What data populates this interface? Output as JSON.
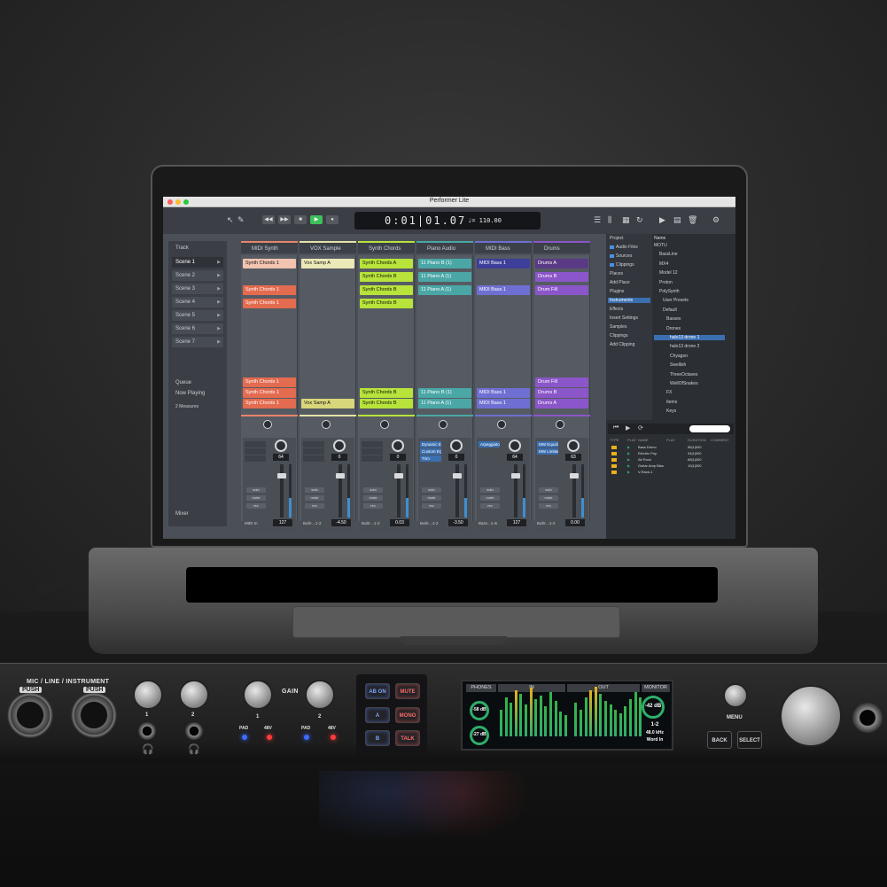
{
  "window": {
    "title": "Performer Lite"
  },
  "toolbar": {
    "counter": "0:01|01.07",
    "tempo": "♩= 110.00",
    "icons": [
      "pointer-icon",
      "pencil-icon",
      "rewind-icon",
      "fast-forward-icon",
      "stop-icon",
      "play-icon",
      "record-icon"
    ]
  },
  "clips_panel": {
    "track_label": "Track",
    "scenes": [
      "Scene 1",
      "Scene 2",
      "Scene 3",
      "Scene 4",
      "Scene 5",
      "Scene 6",
      "Scene 7"
    ],
    "queue_label": "Queue",
    "now_playing_label": "Now Playing",
    "quantize": "2 Measures",
    "mixer_label": "Mixer"
  },
  "tracks": [
    {
      "name": "MIDI Synth",
      "color": "#e8846a",
      "clips": [
        {
          "row": 0,
          "label": "Synth Chords 1",
          "color": "#f1c3b0"
        },
        {
          "row": 2,
          "label": "Synth Chords 1",
          "color": "#e36b4f"
        },
        {
          "row": 3,
          "label": "Synth Chords 1",
          "color": "#e36b4f"
        }
      ],
      "queue": [
        "Synth Chords 1",
        "Synth Chords 1",
        "Synth Chords 1"
      ],
      "queue_color": "#e36b4f",
      "inserts": [],
      "pan": "64",
      "volume": "127",
      "output": "MIDI In"
    },
    {
      "name": "VOX Sample",
      "color": "#e5e2a5",
      "clips": [
        {
          "row": 0,
          "label": "Vox Samp A",
          "color": "#ece9b8"
        }
      ],
      "queue": [
        "",
        "",
        "Vox Samp A"
      ],
      "queue_color": "#d8d67a",
      "inserts": [],
      "pan": "0",
      "volume": "-4.50",
      "output": "Built-...1-2"
    },
    {
      "name": "Synth Chords",
      "color": "#b7e33a",
      "clips": [
        {
          "row": 0,
          "label": "Synth Chords A",
          "color": "#b7e33a"
        },
        {
          "row": 1,
          "label": "Synth Chords B",
          "color": "#b7e33a"
        },
        {
          "row": 2,
          "label": "Synth Chords B",
          "color": "#b7e33a"
        },
        {
          "row": 3,
          "label": "Synth Chords B",
          "color": "#b7e33a"
        }
      ],
      "queue": [
        "",
        "Synth Chords B",
        "Synth Chords B"
      ],
      "queue_color": "#b7e33a",
      "inserts": [],
      "pan": "0",
      "volume": "0.03",
      "output": "Built-...1-2"
    },
    {
      "name": "Piano Audio",
      "color": "#4aa7a6",
      "clips": [
        {
          "row": 0,
          "label": "11 Piano B (1)",
          "color": "#4aa7a6"
        },
        {
          "row": 1,
          "label": "11 Piano A (1)",
          "color": "#4aa7a6"
        },
        {
          "row": 2,
          "label": "11 Piano A (1)",
          "color": "#4aa7a6"
        }
      ],
      "queue": [
        "",
        "11 Piano B (1)",
        "11 Piano A (1)"
      ],
      "queue_color": "#4aa7a6",
      "inserts": [
        "Dynamic E...",
        "Custom EQ",
        "Trim"
      ],
      "pan": "0",
      "volume": "-3.50",
      "output": "Built-...1-2"
    },
    {
      "name": "MIDI Bass",
      "color": "#6f6fd3",
      "clips": [
        {
          "row": 0,
          "label": "MIDI Bass 1",
          "color": "#3d3f9a"
        },
        {
          "row": 2,
          "label": "MIDI Bass 1",
          "color": "#6f6fd3"
        }
      ],
      "queue": [
        "",
        "MIDI Bass 1",
        "MIDI Bass 1"
      ],
      "queue_color": "#6f6fd3",
      "inserts": [
        "Arpeggiator"
      ],
      "pan": "64",
      "volume": "127",
      "output": "Bass...1-in"
    },
    {
      "name": "Drums",
      "color": "#8b56c9",
      "clips": [
        {
          "row": 0,
          "label": "Drums A",
          "color": "#5a3a85"
        },
        {
          "row": 1,
          "label": "Drums B",
          "color": "#8b56c9"
        },
        {
          "row": 2,
          "label": "Drum Fill",
          "color": "#8b56c9"
        }
      ],
      "queue": [
        "Drum Fill",
        "Drums B",
        "Drums A"
      ],
      "queue_color": "#8b56c9",
      "inserts": [
        "MW Equali...",
        "MW Limiter"
      ],
      "pan": "63",
      "volume": "0.00",
      "output": "Built-...1-2"
    }
  ],
  "strip_buttons": [
    "solo",
    "mute",
    "rec"
  ],
  "browser": {
    "left": [
      "Project",
      "Audio Files",
      "Sources",
      "Clippings",
      "Places",
      "Add Place",
      "Plugins",
      "Instruments",
      "Effects",
      "Insert Settings",
      "Samples",
      "Clippings",
      "Add Clipping"
    ],
    "name_header": "Name",
    "tree": [
      "MOTU",
      "BassLine",
      "MX4",
      "Model 12",
      "Proton",
      "PolySynth",
      "User Presets",
      "Default",
      "Basses",
      "Drones",
      "halo13 drone 1",
      "halo13 drone 2",
      "Chyagon",
      "Swellish",
      "ThreeOctaves",
      "WellOfSnakes",
      "FX",
      "Items",
      "Keys"
    ],
    "tree_selected": "halo13 drone 1",
    "list_headers": [
      "TYPE",
      "PLAY",
      "NAME",
      "PLAY",
      "DURATION",
      "COMMENT"
    ],
    "list": [
      {
        "name": "Bass Demo",
        "dur": "56|1|000"
      },
      {
        "name": "Electric Pop",
        "dur": "34|1|000"
      },
      {
        "name": "Alt Rock",
        "dur": "65|1|000"
      },
      {
        "name": "Guitar Amp Blas",
        "dur": "10|1|000"
      },
      {
        "name": "V-Rack-1",
        "dur": ""
      }
    ]
  },
  "interface": {
    "input_label": "MIC / LINE / INSTRUMENT",
    "push_label": "PUSH",
    "ch1": "1",
    "ch2": "2",
    "gain_label": "GAIN",
    "pad_label": "PAD",
    "phantom_label": "48V",
    "buttons": [
      {
        "label": "AB ON",
        "color": "blue"
      },
      {
        "label": "MUTE",
        "color": "red"
      },
      {
        "label": "A",
        "color": "blue"
      },
      {
        "label": "MONO",
        "color": "red"
      },
      {
        "label": "B",
        "color": "blue"
      },
      {
        "label": "TALK",
        "color": "red"
      }
    ],
    "menu_label": "MENU",
    "back_label": "BACK",
    "select_label": "SELECT",
    "lcd": {
      "tabs": [
        "PHONES",
        "IN",
        "OUT",
        "MONITOR"
      ],
      "phones1": "-58 dB",
      "phones2": "-27 dB",
      "monitor_level": "-42 dB",
      "monitor_out": "1-2",
      "sample_rate": "48.0 kHz",
      "clock": "Word In"
    }
  }
}
